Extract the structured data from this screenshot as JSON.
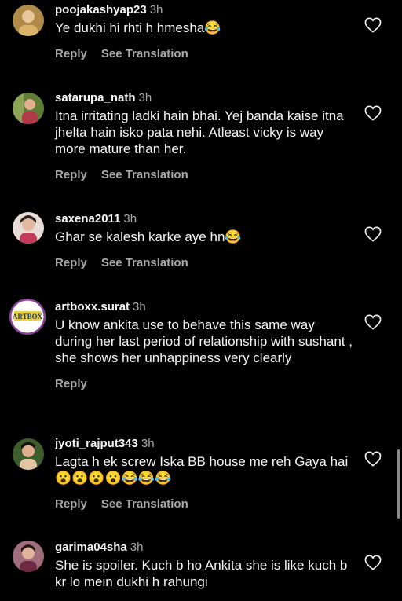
{
  "comments": [
    {
      "username": "poojakashyap23",
      "time": "3h",
      "text": "Ye dukhi hi rhti h hmesha😂",
      "reply": "Reply",
      "translate": "See Translation",
      "avatar_color": "#c7a15a",
      "like_icon": "heart-outline-icon"
    },
    {
      "username": "satarupa_nath",
      "time": "3h",
      "text": "Itna irritating ladki hain bhai. Yej banda kaise itna jhelta hain isko pata nehi. Atleast vicky is way more mature than her.",
      "reply": "Reply",
      "translate": "See Translation",
      "avatar_color": "#6c8a3e",
      "like_icon": "heart-outline-icon"
    },
    {
      "username": "saxena2011",
      "time": "3h",
      "text": "Ghar se kalesh karke aye hn😂",
      "reply": "Reply",
      "translate": "See Translation",
      "avatar_color": "#d9b7a8",
      "like_icon": "heart-outline-icon"
    },
    {
      "username": "artboxx.surat",
      "time": "3h",
      "text": "U know ankita use to behave this same way during her last period of relationship with sushant , she shows her unhappiness very clearly",
      "reply": "Reply",
      "translate": "",
      "avatar_color": "#7a3f8a",
      "avatar_text": "ARTBOX",
      "like_icon": "heart-outline-icon"
    },
    {
      "username": "jyoti_rajput343",
      "time": "3h",
      "text": "Lagta h ek screw Iska BB house me reh Gaya hai 😮😮😮😮😂😂😂",
      "reply": "Reply",
      "translate": "See Translation",
      "avatar_color": "#4c6b3a",
      "like_icon": "heart-outline-icon"
    },
    {
      "username": "garima04sha",
      "time": "3h",
      "text": "She is spoiler. Kuch b ho Ankita she is like kuch b kr lo mein dukhi h rahungi",
      "reply": "",
      "translate": "",
      "avatar_color": "#8a5a6a",
      "like_icon": "heart-outline-icon"
    }
  ]
}
